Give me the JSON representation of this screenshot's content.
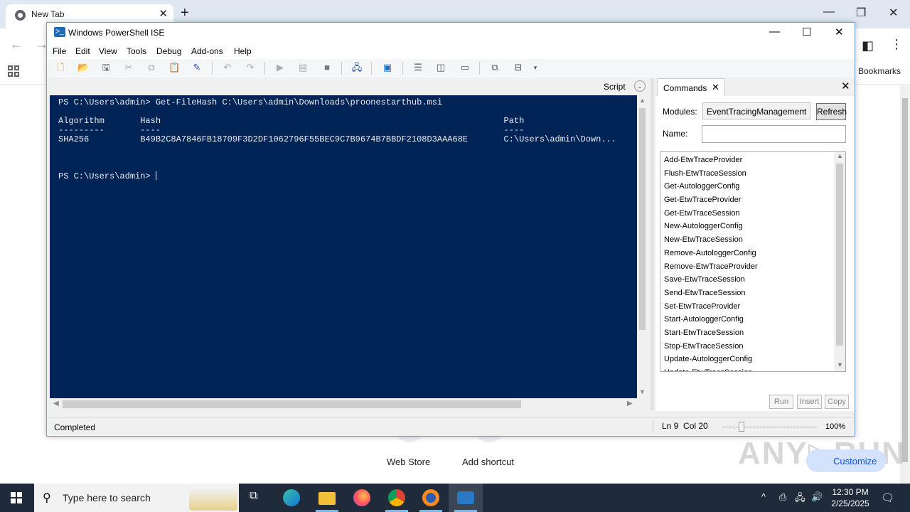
{
  "browser": {
    "tab_title": "New Tab",
    "tab_close": "✕",
    "new_tab": "+",
    "bookmarks_label": "Bookmarks",
    "shortcuts": [
      {
        "label": "Web Store"
      },
      {
        "label": "Add shortcut"
      }
    ],
    "customize_label": "Customize",
    "watermark": "ANY RUN"
  },
  "ise": {
    "title": "Windows PowerShell ISE",
    "menu": [
      "File",
      "Edit",
      "View",
      "Tools",
      "Debug",
      "Add-ons",
      "Help"
    ],
    "script_label": "Script",
    "console_lines": {
      "command": "PS C:\\Users\\admin> Get-FileHash C:\\Users\\admin\\Downloads\\proonestarthub.msi",
      "headers": "Algorithm       Hash                                                                   Path",
      "dashes": "---------       ----                                                                   ----",
      "row": "SHA256          B49B2C8A7846FB18709F3D2DF1062796F55BEC9C7B9674B7BBDF2108D3AAA68E       C:\\Users\\admin\\Down...",
      "prompt": "PS C:\\Users\\admin> "
    },
    "commands_panel": {
      "tab_label": "Commands",
      "modules_label": "Modules:",
      "modules_value": "EventTracingManagement",
      "refresh_label": "Refresh",
      "name_label": "Name:",
      "name_value": "",
      "items": [
        "Add-EtwTraceProvider",
        "Flush-EtwTraceSession",
        "Get-AutologgerConfig",
        "Get-EtwTraceProvider",
        "Get-EtwTraceSession",
        "New-AutologgerConfig",
        "New-EtwTraceSession",
        "Remove-AutologgerConfig",
        "Remove-EtwTraceProvider",
        "Save-EtwTraceSession",
        "Send-EtwTraceSession",
        "Set-EtwTraceProvider",
        "Start-AutologgerConfig",
        "Start-EtwTraceSession",
        "Stop-EtwTraceSession",
        "Update-AutologgerConfig",
        "Update-EtwTraceSession"
      ],
      "run_label": "Run",
      "insert_label": "Insert",
      "copy_label": "Copy"
    },
    "status": {
      "text": "Completed",
      "position": "Ln 9  Col 20",
      "zoom": "100%"
    }
  },
  "taskbar": {
    "search_placeholder": "Type here to search",
    "time": "12:30 PM",
    "date": "2/25/2025"
  }
}
